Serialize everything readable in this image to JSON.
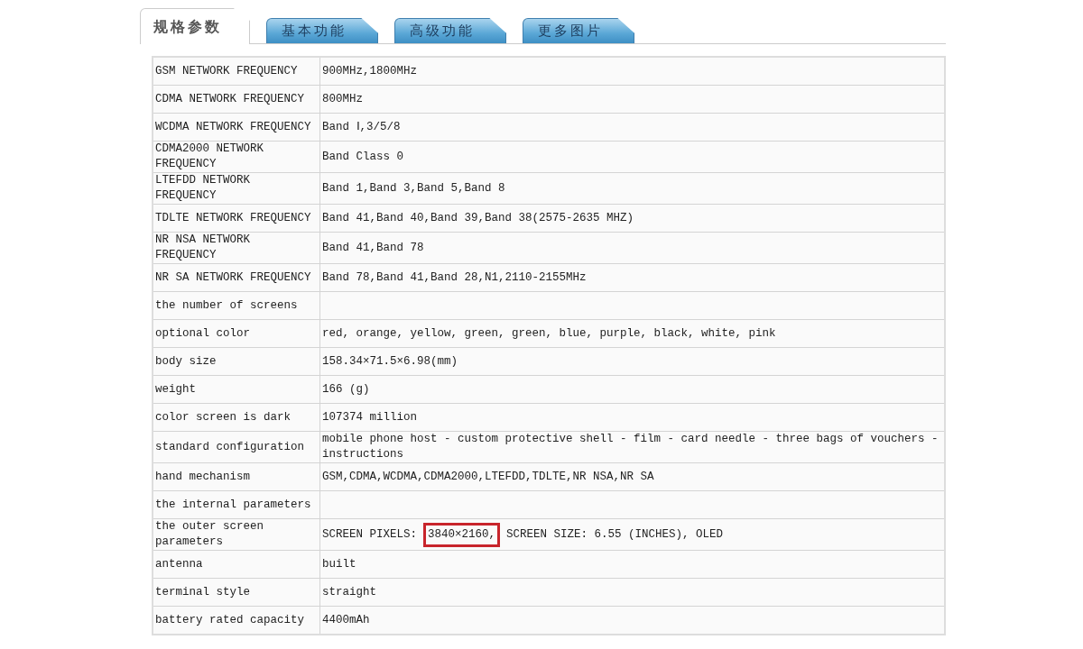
{
  "tabs": [
    {
      "label": "规格参数",
      "selected": true
    },
    {
      "label": "基本功能",
      "selected": false
    },
    {
      "label": "高级功能",
      "selected": false
    },
    {
      "label": "更多图片",
      "selected": false
    }
  ],
  "table": {
    "rows": [
      {
        "label": "GSM NETWORK FREQUENCY",
        "value": "900MHz,1800MHz"
      },
      {
        "label": "CDMA NETWORK FREQUENCY",
        "value": "800MHz"
      },
      {
        "label": "WCDMA NETWORK FREQUENCY",
        "value": "Band Ⅰ,3/5/8"
      },
      {
        "label": "CDMA2000 NETWORK FREQUENCY",
        "value": "Band Class 0"
      },
      {
        "label": "LTEFDD NETWORK FREQUENCY",
        "value": "Band 1,Band 3,Band 5,Band 8"
      },
      {
        "label": "TDLTE NETWORK FREQUENCY",
        "value": "Band 41,Band 40,Band 39,Band 38(2575-2635 MHZ)"
      },
      {
        "label": "NR NSA NETWORK FREQUENCY",
        "value": "Band 41,Band 78"
      },
      {
        "label": "NR SA NETWORK FREQUENCY",
        "value": "Band 78,Band 41,Band 28,N1,2110-2155MHz"
      },
      {
        "label": "the number of screens"
      },
      {
        "label": "optional color",
        "value": "red, orange, yellow, green, green, blue, purple, black, white, pink"
      },
      {
        "label": "body size",
        "value": "158.34×71.5×6.98(mm)"
      },
      {
        "label": "weight",
        "value": "166 (g)"
      },
      {
        "label": "color screen is dark",
        "value": "107374 million"
      },
      {
        "label": "standard configuration",
        "value": "mobile phone host - custom protective shell - film - card needle - three bags of vouchers - instructions"
      },
      {
        "label": "hand mechanism",
        "value": "GSM,CDMA,WCDMA,CDMA2000,LTEFDD,TDLTE,NR NSA,NR SA"
      },
      {
        "label": "the internal parameters"
      },
      {
        "label": "the outer screen parameters",
        "value_parts": [
          {
            "text": "SCREEN PIXELS:",
            "highlighted": false
          },
          {
            "text": "3840×2160,",
            "highlighted": true
          },
          {
            "text": "SCREEN SIZE: 6.55 (INCHES), OLED",
            "highlighted": false
          }
        ]
      },
      {
        "label": "antenna",
        "value": "built"
      },
      {
        "label": "terminal style",
        "value": "straight"
      },
      {
        "label": "battery rated capacity",
        "value": "4400mAh"
      }
    ]
  }
}
